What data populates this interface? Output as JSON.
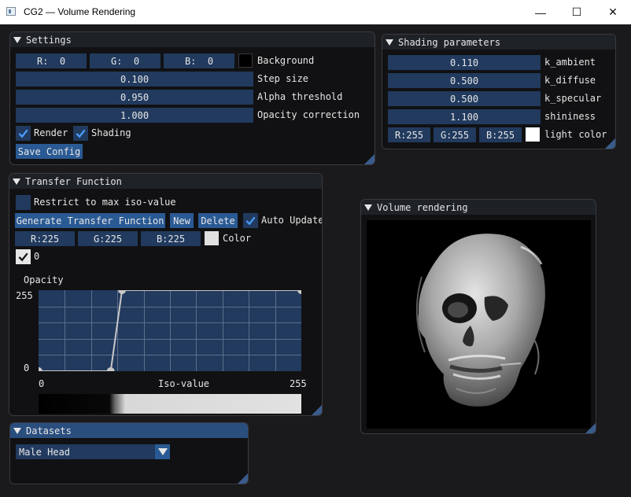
{
  "window": {
    "title": "CG2 — Volume Rendering",
    "minimize": "—",
    "maximize": "☐",
    "close": "✕"
  },
  "settings": {
    "title": "Settings",
    "bg_r": "R:  0",
    "bg_g": "G:  0",
    "bg_b": "B:  0",
    "background_color": "#000000",
    "background_label": "Background",
    "step_size_value": "0.100",
    "step_size_label": "Step size",
    "alpha_threshold_value": "0.950",
    "alpha_threshold_label": "Alpha threshold",
    "opacity_correction_value": "1.000",
    "opacity_correction_label": "Opacity correction",
    "render_label": "Render",
    "render_checked": true,
    "shading_label": "Shading",
    "shading_checked": true,
    "save_config_label": "Save Config"
  },
  "shading": {
    "title": "Shading parameters",
    "k_ambient_value": "0.110",
    "k_ambient_label": "k_ambient",
    "k_diffuse_value": "0.500",
    "k_diffuse_label": "k_diffuse",
    "k_specular_value": "0.500",
    "k_specular_label": "k_specular",
    "shininess_value": "1.100",
    "shininess_label": "shininess",
    "light_r": "R:255",
    "light_g": "G:255",
    "light_b": "B:255",
    "light_color": "#ffffff",
    "light_color_label": "light color"
  },
  "transfer": {
    "title": "Transfer Function",
    "restrict_label": "Restrict to max iso-value",
    "restrict_checked": false,
    "generate_label": "Generate Transfer Function",
    "new_label": "New",
    "delete_label": "Delete",
    "auto_update_label": "Auto Update",
    "auto_update_checked": true,
    "color_r": "R:225",
    "color_g": "G:225",
    "color_b": "B:225",
    "color_swatch": "#e1e1e1",
    "color_label": "Color",
    "zero_label": "0",
    "zero_checked": true,
    "opacity_label": "Opacity",
    "y_max_label": "255",
    "y_min_label": "0",
    "x_min_label": "0",
    "x_label": "Iso-value",
    "x_max_label": "255"
  },
  "chart_data": {
    "type": "line",
    "x": [
      0,
      70,
      81,
      255
    ],
    "y": [
      0,
      0,
      255,
      255
    ],
    "xlim": [
      0,
      255
    ],
    "ylim": [
      0,
      255
    ],
    "ylabel": "Opacity",
    "xlabel": "Iso-value",
    "grid": true
  },
  "volume": {
    "title": "Volume rendering"
  },
  "datasets": {
    "title": "Datasets",
    "selected": "Male Head"
  },
  "colors": {
    "accent": "#2a5a94",
    "field": "#213a5e",
    "panel_title_active": "#2a4e7e"
  }
}
